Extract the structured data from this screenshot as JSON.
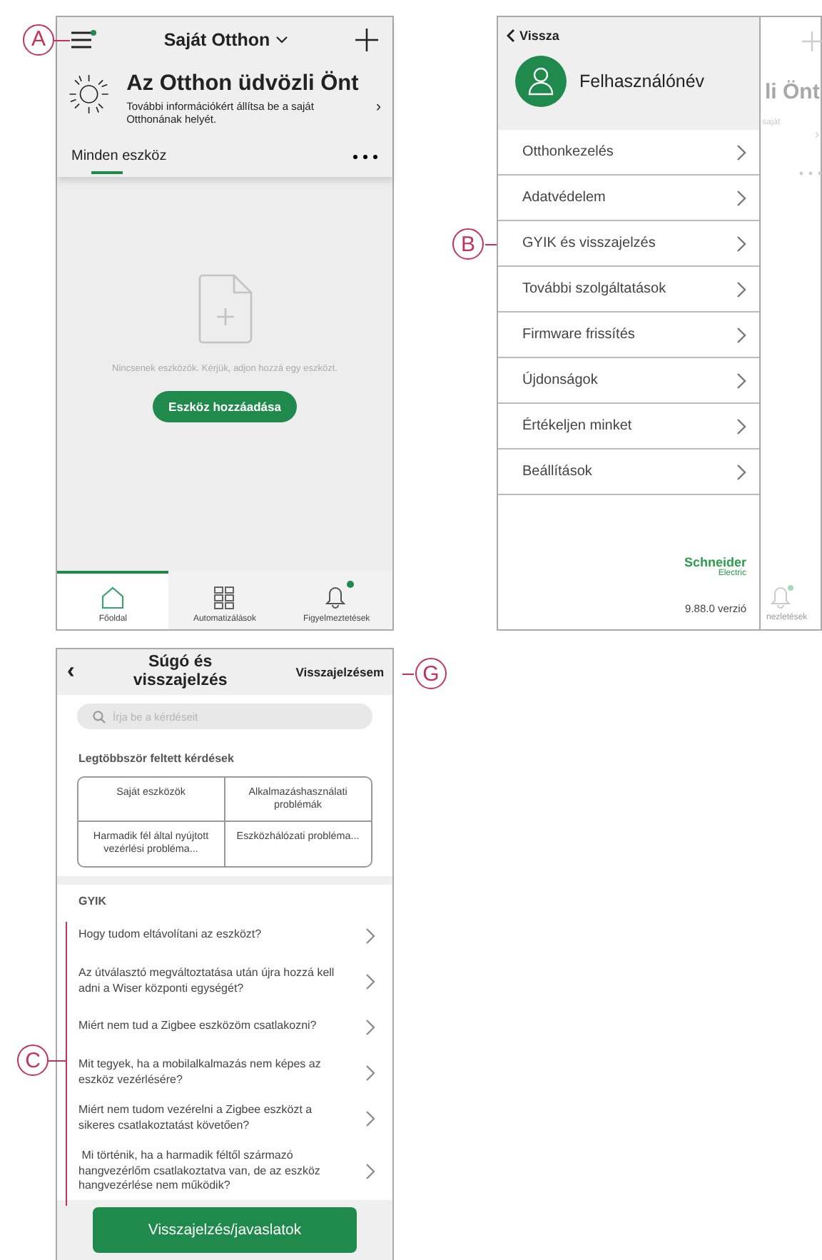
{
  "home": {
    "callout": "A",
    "menu_notification": true,
    "title": "Saját Otthon",
    "welcome": {
      "title": "Az Otthon üdvözli Önt",
      "text": "További információkért állítsa be a saját Otthonának helyét.",
      "chevron": "›"
    },
    "filter_tab": {
      "label": "Minden eszköz",
      "selected": true
    },
    "empty_text": "Nincsenek eszközök. Kérjük, adjon hozzá egy eszközt.",
    "add_button": "Eszköz hozzáadása",
    "tabs": [
      {
        "kind": "home",
        "label": "Főoldal",
        "selected": true,
        "notification": false
      },
      {
        "kind": "automations",
        "label": "Automatizálások",
        "selected": false,
        "notification": false
      },
      {
        "kind": "alerts",
        "label": "Figyelmeztetések",
        "selected": false,
        "notification": true
      }
    ]
  },
  "menu": {
    "back": "Vissza",
    "username": "Felhasználónév",
    "items": [
      {
        "label": "Otthonkezelés"
      },
      {
        "label": "Adatvédelem"
      },
      {
        "label": "GYIK és visszajelzés",
        "callout": "B"
      },
      {
        "label": "További szolgáltatások"
      },
      {
        "label": "Firmware frissítés"
      },
      {
        "label": "Újdonságok"
      },
      {
        "label": "Értékeljen minket"
      },
      {
        "label": "Beállítások"
      }
    ],
    "brand": {
      "name": "Schneider",
      "sub": "Electric"
    },
    "version": "9.88.0 verzió",
    "background_screen": {
      "title_fragment": "li Önt",
      "text_fragment": "saját",
      "chevron": "›",
      "tab_fragment": "nezletések"
    }
  },
  "help": {
    "back": "‹",
    "title": "Súgó és visszajelzés",
    "feedback_link": "Visszajelzésem",
    "feedback_callout": "G",
    "search": {
      "placeholder": "Írja be a kérdéseit"
    },
    "top_questions_heading": "Legtöbbször feltett kérdések",
    "top_questions": [
      "Saját eszközök",
      "Alkalmazáshasználati problémák",
      "Harmadik fél által nyújtott vezérlési probléma...",
      "Eszközhálózati probléma..."
    ],
    "faq_heading": "GYIK",
    "faq_callout": "C",
    "faq": [
      "Hogy tudom eltávolítani az eszközt?",
      "Az útválasztó megváltoztatása után újra hozzá kell adni a Wiser központi egységét?",
      "Miért nem tud a Zigbee eszközöm csatlakozni?",
      "Mit tegyek, ha a mobilalkalmazás nem képes az eszköz vezérlésére?",
      "Miért nem tudom vezérelni a Zigbee eszközt a sikeres csatlakoztatást követően?",
      " Mi történik, ha a harmadik féltől származó hangvezérlőm csatlakoztatva van, de az eszköz hangvezérlése nem működik?"
    ],
    "feedback_button": "Visszajelzés/javaslatok"
  }
}
